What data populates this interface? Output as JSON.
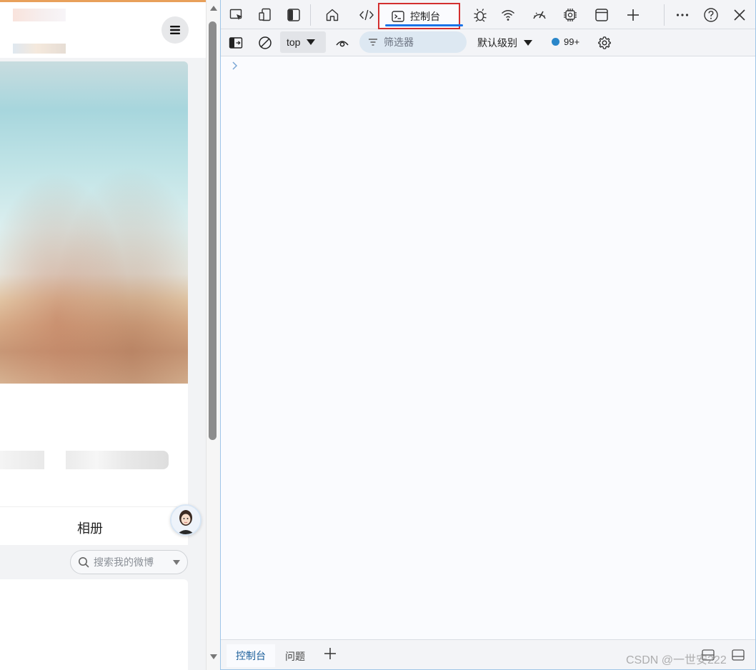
{
  "page_preview": {
    "album_tab_label": "相册",
    "search": {
      "placeholder": "搜索我的微博"
    },
    "menu_icon": "hamburger-menu-icon",
    "avatar_icon": "user-avatar"
  },
  "devtools": {
    "tabs": [
      {
        "icon": "inspect-element-icon"
      },
      {
        "icon": "device-emulation-icon"
      },
      {
        "icon": "dock-sidebar-icon"
      },
      {
        "icon": "home-icon"
      },
      {
        "icon": "elements-code-icon"
      },
      {
        "icon": "console-icon",
        "label": "控制台",
        "selected": true
      },
      {
        "icon": "sources-bug-icon"
      },
      {
        "icon": "network-wifi-icon"
      },
      {
        "icon": "performance-gauge-icon"
      },
      {
        "icon": "memory-chip-icon"
      },
      {
        "icon": "application-window-icon"
      },
      {
        "icon": "add-tool-icon"
      }
    ],
    "more_icon": "more-tools-icon",
    "help_icon": "help-icon",
    "close_icon": "close-icon",
    "toolbar": {
      "context_value": "top",
      "filter_placeholder": "筛选器",
      "level_value": "默认级别",
      "issue_count": "99+"
    },
    "drawer": {
      "console_label": "控制台",
      "issues_label": "问题"
    }
  },
  "colors": {
    "accent": "#1a73e8",
    "highlight_box": "#d32f2f",
    "issue_dot": "#2a86c9"
  },
  "watermark": "CSDN @一世安222"
}
